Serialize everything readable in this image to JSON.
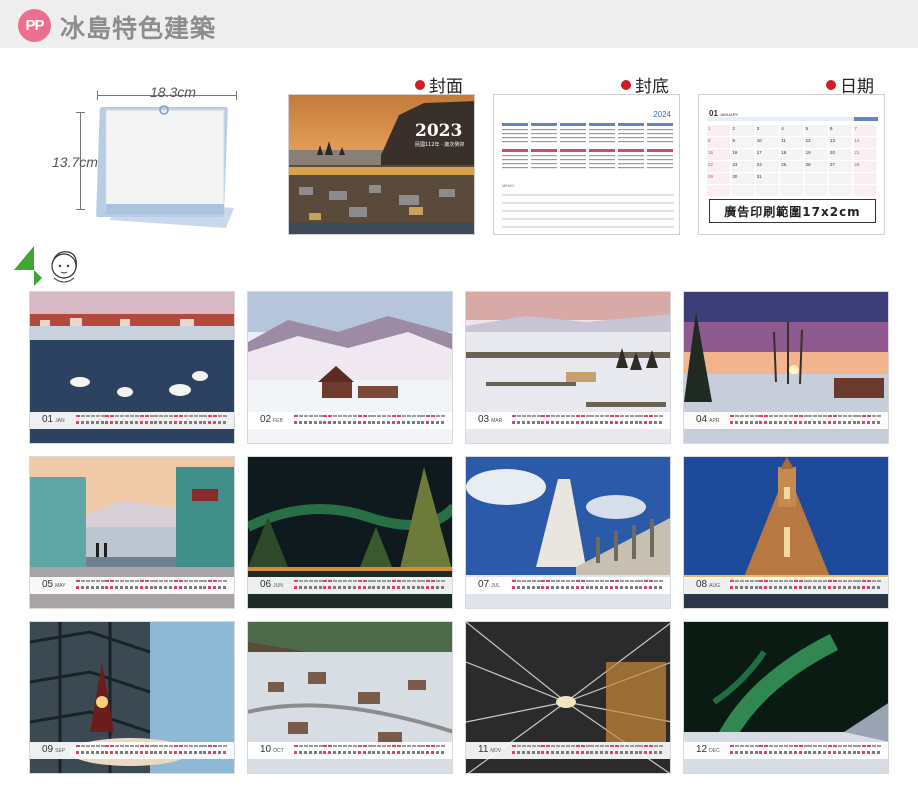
{
  "header": {
    "badge": "PP",
    "title": "冰島特色建築"
  },
  "size": {
    "width": "18.3cm",
    "height": "13.7cm"
  },
  "previews": {
    "cover": {
      "label": "封面",
      "year": "2023",
      "subtitle": "民國112年 · 歲次癸卯"
    },
    "back": {
      "label": "封底",
      "year": "2024"
    },
    "date": {
      "label": "日期",
      "month": "01",
      "month_name": "JANUARY",
      "ad_text": "廣告印刷範圍17x2cm"
    }
  },
  "months": [
    {
      "num": "01",
      "abbr": "JAN",
      "scene": "swans"
    },
    {
      "num": "02",
      "abbr": "FEB",
      "scene": "farm"
    },
    {
      "num": "03",
      "abbr": "MAR",
      "scene": "snowfield"
    },
    {
      "num": "04",
      "abbr": "APR",
      "scene": "sunset"
    },
    {
      "num": "05",
      "abbr": "MAY",
      "scene": "street"
    },
    {
      "num": "06",
      "abbr": "JUN",
      "scene": "aurora-trees"
    },
    {
      "num": "07",
      "abbr": "JUL",
      "scene": "church-day"
    },
    {
      "num": "08",
      "abbr": "AUG",
      "scene": "church-night"
    },
    {
      "num": "09",
      "abbr": "SEP",
      "scene": "harpa-window"
    },
    {
      "num": "10",
      "abbr": "OCT",
      "scene": "town"
    },
    {
      "num": "11",
      "abbr": "NOV",
      "scene": "harpa-interior"
    },
    {
      "num": "12",
      "abbr": "DEC",
      "scene": "aurora"
    }
  ],
  "colors": {
    "badge": "#ec6f8f",
    "title": "#8d8d8d",
    "bullet": "#d01c22",
    "accent_blue": "#3f6fb6",
    "accent_red": "#d9456a"
  }
}
